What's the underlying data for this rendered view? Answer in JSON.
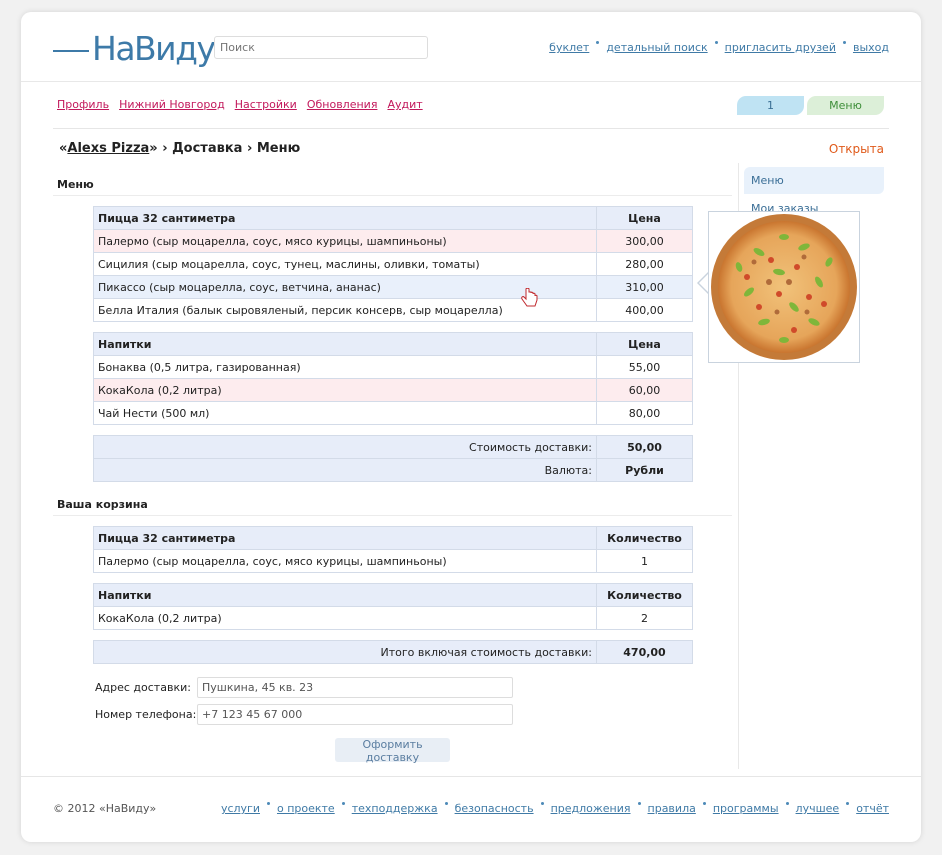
{
  "header": {
    "logo_text": "НаВиду",
    "search_placeholder": "Поиск",
    "links": [
      "буклет",
      "детальный поиск",
      "пригласить друзей",
      "выход"
    ]
  },
  "nav": {
    "links": [
      "Профиль",
      "Нижний Новгород",
      "Настройки",
      "Обновления",
      "Аудит"
    ],
    "counter_badge": "1",
    "menu_badge": "Меню"
  },
  "breadcrumb": {
    "quote_open": "«",
    "restaurant": "Alexs Pizza",
    "quote_close": "»",
    "rest": " › Доставка › Меню",
    "status": "Открыта"
  },
  "sidebar": {
    "active_item": "Меню",
    "item2": "Мои заказы"
  },
  "menu": {
    "section_title": "Меню",
    "pizza_header": "Пицца 32 сантиметра",
    "price_header": "Цена",
    "pizzas": [
      {
        "name": "Палермо (сыр моцарелла, соус, мясо курицы, шампиньоны)",
        "price": "300,00"
      },
      {
        "name": "Сицилия (сыр моцарелла, соус, тунец, маслины, оливки, томаты)",
        "price": "280,00"
      },
      {
        "name": "Пикассо (сыр моцарелла, соус, ветчина, ананас)",
        "price": "310,00"
      },
      {
        "name": "Белла Италия (балык сыровяленый, персик консерв, сыр моцарелла)",
        "price": "400,00"
      }
    ],
    "drinks_header": "Напитки",
    "drinks": [
      {
        "name": "Бонаква (0,5 литра, газированная)",
        "price": "55,00"
      },
      {
        "name": "КокаКола (0,2 литра)",
        "price": "60,00"
      },
      {
        "name": "Чай Нести (500 мл)",
        "price": "80,00"
      }
    ],
    "delivery_label": "Стоимость доставки:",
    "delivery_value": "50,00",
    "currency_label": "Валюта:",
    "currency_value": "Рубли"
  },
  "cart": {
    "section_title": "Ваша корзина",
    "pizza_header": "Пицца 32 сантиметра",
    "qty_header": "Количество",
    "pizzas": [
      {
        "name": "Палермо (сыр моцарелла, соус, мясо курицы, шампиньоны)",
        "qty": "1"
      }
    ],
    "drinks_header": "Напитки",
    "drinks": [
      {
        "name": "КокаКола (0,2 литра)",
        "qty": "2"
      }
    ],
    "total_label": "Итого включая стоимость доставки:",
    "total_value": "470,00"
  },
  "form": {
    "address_label": "Адрес доставки:",
    "address_value": "Пушкина, 45 кв. 23",
    "phone_label": "Номер телефона:",
    "phone_value": "+7 123 45 67 000",
    "submit_label": "Оформить доставку"
  },
  "footer": {
    "copyright": "© 2012 «НаВиду»",
    "links": [
      "услуги",
      "о проекте",
      "техподдержка",
      "безопасность",
      "предложения",
      "правила",
      "программы",
      "лучшее",
      "отчёт"
    ]
  },
  "colors": {
    "accent_blue": "#3f7aa6",
    "nav_pink": "#c2185b",
    "status_orange": "#e05a1a",
    "table_header": "#e7edf9",
    "row_pink": "#fdecee"
  },
  "icons": [
    "pizza-image",
    "hand-cursor-icon"
  ]
}
